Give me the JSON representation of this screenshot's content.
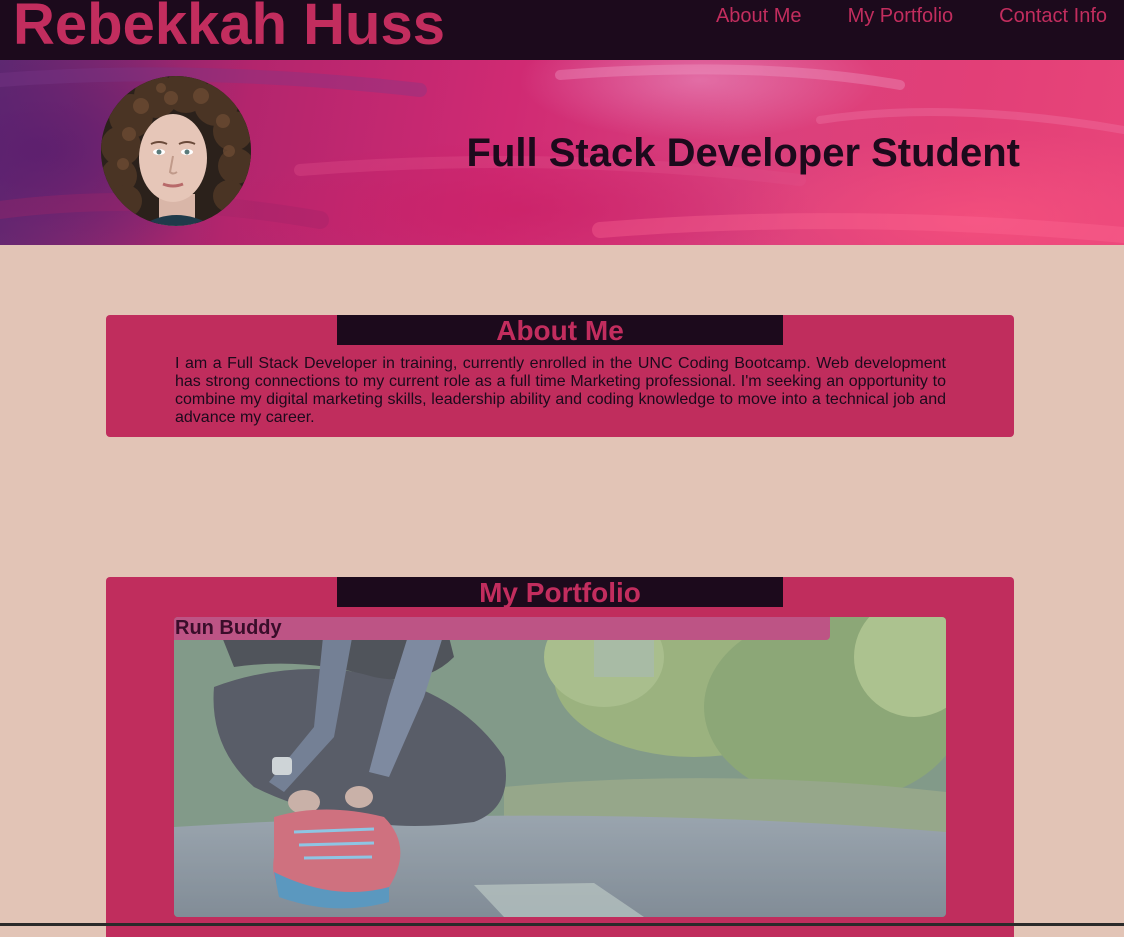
{
  "header": {
    "site_title": "Rebekkah Huss",
    "nav": [
      {
        "label": "About Me"
      },
      {
        "label": "My Portfolio"
      },
      {
        "label": "Contact Info"
      }
    ]
  },
  "hero": {
    "tagline": "Full Stack Developer Student",
    "avatar_icon": "profile-photo"
  },
  "about": {
    "heading": "About Me",
    "body": "I am a Full Stack Developer in training, currently enrolled in the UNC Coding Bootcamp. Web development has strong connections to my current role as a full time Marketing professional. I'm seeking an opportunity to combine my digital marketing skills, leadership ability and coding knowledge to move into a technical job and advance my career."
  },
  "portfolio": {
    "heading": "My Portfolio",
    "projects": [
      {
        "title": "Run Buddy",
        "image_icon": "runner-tying-shoe-photo"
      }
    ]
  },
  "colors": {
    "page_background": "#e2c4b6",
    "header_background": "#1c0a1c",
    "accent": "#c22d5e",
    "section_background": "#c02d5d",
    "dark_text": "#1c0a1c"
  }
}
